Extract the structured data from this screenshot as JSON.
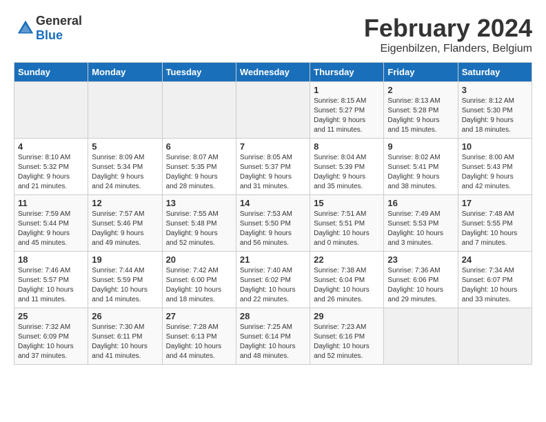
{
  "header": {
    "logo_general": "General",
    "logo_blue": "Blue",
    "title": "February 2024",
    "location": "Eigenbilzen, Flanders, Belgium"
  },
  "days_of_week": [
    "Sunday",
    "Monday",
    "Tuesday",
    "Wednesday",
    "Thursday",
    "Friday",
    "Saturday"
  ],
  "weeks": [
    [
      {
        "day": "",
        "info": ""
      },
      {
        "day": "",
        "info": ""
      },
      {
        "day": "",
        "info": ""
      },
      {
        "day": "",
        "info": ""
      },
      {
        "day": "1",
        "info": "Sunrise: 8:15 AM\nSunset: 5:27 PM\nDaylight: 9 hours\nand 11 minutes."
      },
      {
        "day": "2",
        "info": "Sunrise: 8:13 AM\nSunset: 5:28 PM\nDaylight: 9 hours\nand 15 minutes."
      },
      {
        "day": "3",
        "info": "Sunrise: 8:12 AM\nSunset: 5:30 PM\nDaylight: 9 hours\nand 18 minutes."
      }
    ],
    [
      {
        "day": "4",
        "info": "Sunrise: 8:10 AM\nSunset: 5:32 PM\nDaylight: 9 hours\nand 21 minutes."
      },
      {
        "day": "5",
        "info": "Sunrise: 8:09 AM\nSunset: 5:34 PM\nDaylight: 9 hours\nand 24 minutes."
      },
      {
        "day": "6",
        "info": "Sunrise: 8:07 AM\nSunset: 5:35 PM\nDaylight: 9 hours\nand 28 minutes."
      },
      {
        "day": "7",
        "info": "Sunrise: 8:05 AM\nSunset: 5:37 PM\nDaylight: 9 hours\nand 31 minutes."
      },
      {
        "day": "8",
        "info": "Sunrise: 8:04 AM\nSunset: 5:39 PM\nDaylight: 9 hours\nand 35 minutes."
      },
      {
        "day": "9",
        "info": "Sunrise: 8:02 AM\nSunset: 5:41 PM\nDaylight: 9 hours\nand 38 minutes."
      },
      {
        "day": "10",
        "info": "Sunrise: 8:00 AM\nSunset: 5:43 PM\nDaylight: 9 hours\nand 42 minutes."
      }
    ],
    [
      {
        "day": "11",
        "info": "Sunrise: 7:59 AM\nSunset: 5:44 PM\nDaylight: 9 hours\nand 45 minutes."
      },
      {
        "day": "12",
        "info": "Sunrise: 7:57 AM\nSunset: 5:46 PM\nDaylight: 9 hours\nand 49 minutes."
      },
      {
        "day": "13",
        "info": "Sunrise: 7:55 AM\nSunset: 5:48 PM\nDaylight: 9 hours\nand 52 minutes."
      },
      {
        "day": "14",
        "info": "Sunrise: 7:53 AM\nSunset: 5:50 PM\nDaylight: 9 hours\nand 56 minutes."
      },
      {
        "day": "15",
        "info": "Sunrise: 7:51 AM\nSunset: 5:51 PM\nDaylight: 10 hours\nand 0 minutes."
      },
      {
        "day": "16",
        "info": "Sunrise: 7:49 AM\nSunset: 5:53 PM\nDaylight: 10 hours\nand 3 minutes."
      },
      {
        "day": "17",
        "info": "Sunrise: 7:48 AM\nSunset: 5:55 PM\nDaylight: 10 hours\nand 7 minutes."
      }
    ],
    [
      {
        "day": "18",
        "info": "Sunrise: 7:46 AM\nSunset: 5:57 PM\nDaylight: 10 hours\nand 11 minutes."
      },
      {
        "day": "19",
        "info": "Sunrise: 7:44 AM\nSunset: 5:59 PM\nDaylight: 10 hours\nand 14 minutes."
      },
      {
        "day": "20",
        "info": "Sunrise: 7:42 AM\nSunset: 6:00 PM\nDaylight: 10 hours\nand 18 minutes."
      },
      {
        "day": "21",
        "info": "Sunrise: 7:40 AM\nSunset: 6:02 PM\nDaylight: 10 hours\nand 22 minutes."
      },
      {
        "day": "22",
        "info": "Sunrise: 7:38 AM\nSunset: 6:04 PM\nDaylight: 10 hours\nand 26 minutes."
      },
      {
        "day": "23",
        "info": "Sunrise: 7:36 AM\nSunset: 6:06 PM\nDaylight: 10 hours\nand 29 minutes."
      },
      {
        "day": "24",
        "info": "Sunrise: 7:34 AM\nSunset: 6:07 PM\nDaylight: 10 hours\nand 33 minutes."
      }
    ],
    [
      {
        "day": "25",
        "info": "Sunrise: 7:32 AM\nSunset: 6:09 PM\nDaylight: 10 hours\nand 37 minutes."
      },
      {
        "day": "26",
        "info": "Sunrise: 7:30 AM\nSunset: 6:11 PM\nDaylight: 10 hours\nand 41 minutes."
      },
      {
        "day": "27",
        "info": "Sunrise: 7:28 AM\nSunset: 6:13 PM\nDaylight: 10 hours\nand 44 minutes."
      },
      {
        "day": "28",
        "info": "Sunrise: 7:25 AM\nSunset: 6:14 PM\nDaylight: 10 hours\nand 48 minutes."
      },
      {
        "day": "29",
        "info": "Sunrise: 7:23 AM\nSunset: 6:16 PM\nDaylight: 10 hours\nand 52 minutes."
      },
      {
        "day": "",
        "info": ""
      },
      {
        "day": "",
        "info": ""
      }
    ]
  ]
}
